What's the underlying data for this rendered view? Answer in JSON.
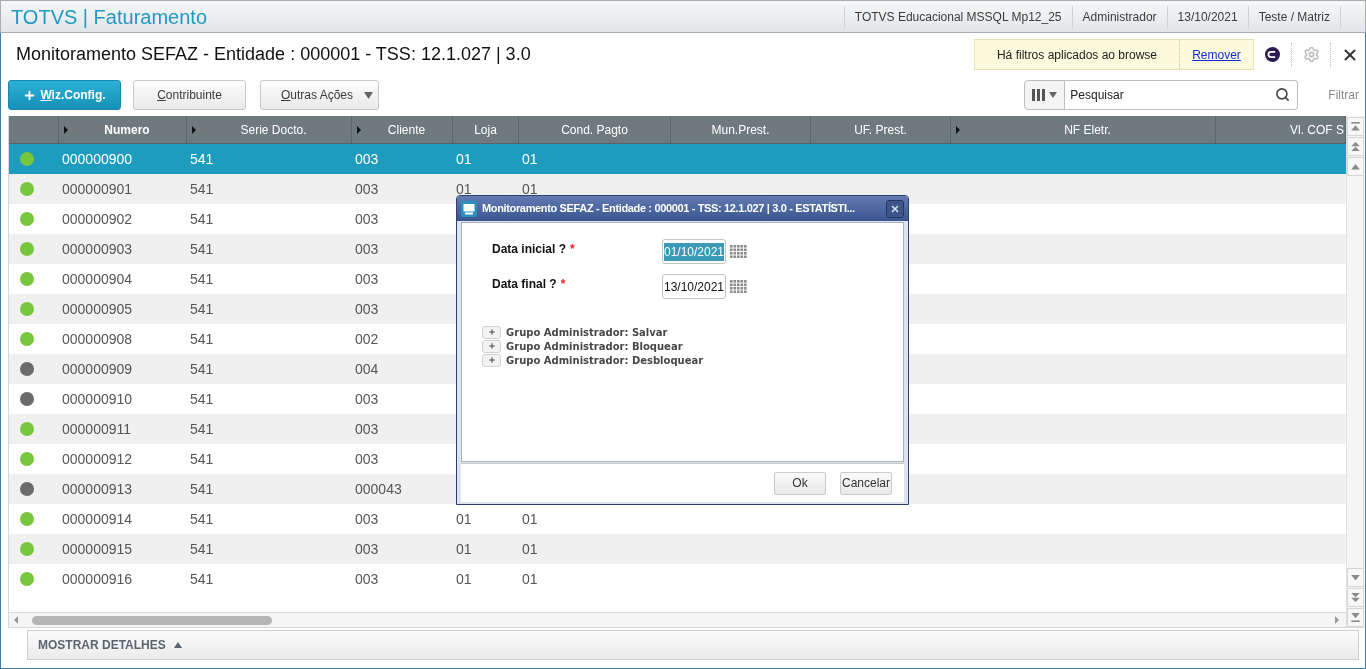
{
  "app_bar": {
    "title": "TOTVS | Faturamento",
    "info": [
      "TOTVS Educacional MSSQL Mp12_25",
      "Administrador",
      "13/10/2021",
      "Teste / Matriz"
    ]
  },
  "page": {
    "title": "Monitoramento SEFAZ - Entidade : 000001 - TSS: 12.1.027 | 3.0"
  },
  "filter_notice": {
    "text": "Há filtros aplicados ao browse",
    "link": "Remover"
  },
  "actions": [
    {
      "label": "Wiz.Config.",
      "kind": "primary"
    },
    {
      "label": "Contribuinte",
      "kind": "default"
    },
    {
      "label": "Outras Ações",
      "kind": "menu"
    }
  ],
  "search": {
    "placeholder": "Pesquisar"
  },
  "filter_link": "Filtrar",
  "table": {
    "columns": [
      {
        "label": "Numero",
        "indexed": true,
        "sorted": true
      },
      {
        "label": "Serie Docto.",
        "indexed": true,
        "sorted": false
      },
      {
        "label": "Cliente",
        "indexed": true,
        "sorted": false
      },
      {
        "label": "Loja",
        "indexed": false,
        "sorted": false
      },
      {
        "label": "Cond. Pagto",
        "indexed": false,
        "sorted": false
      },
      {
        "label": "Mun.Prest.",
        "indexed": false,
        "sorted": false
      },
      {
        "label": "UF. Prest.",
        "indexed": false,
        "sorted": false
      },
      {
        "label": "NF Eletr.",
        "indexed": true,
        "sorted": false
      },
      {
        "label": "Vl. COF S",
        "indexed": false,
        "sorted": false
      }
    ],
    "rows": [
      {
        "color": "#78c63e",
        "selected": true,
        "cells": [
          "000000900",
          "541",
          "003",
          "01",
          "01"
        ]
      },
      {
        "color": "#78c63e",
        "selected": false,
        "cells": [
          "000000901",
          "541",
          "003",
          "01",
          "01"
        ]
      },
      {
        "color": "#78c63e",
        "selected": false,
        "cells": [
          "000000902",
          "541",
          "003"
        ]
      },
      {
        "color": "#78c63e",
        "selected": false,
        "cells": [
          "000000903",
          "541",
          "003"
        ]
      },
      {
        "color": "#78c63e",
        "selected": false,
        "cells": [
          "000000904",
          "541",
          "003"
        ]
      },
      {
        "color": "#78c63e",
        "selected": false,
        "cells": [
          "000000905",
          "541",
          "003"
        ]
      },
      {
        "color": "#78c63e",
        "selected": false,
        "cells": [
          "000000908",
          "541",
          "002"
        ]
      },
      {
        "color": "#6b6b6b",
        "selected": false,
        "cells": [
          "000000909",
          "541",
          "004"
        ]
      },
      {
        "color": "#6b6b6b",
        "selected": false,
        "cells": [
          "000000910",
          "541",
          "003"
        ]
      },
      {
        "color": "#78c63e",
        "selected": false,
        "cells": [
          "000000911",
          "541",
          "003"
        ]
      },
      {
        "color": "#78c63e",
        "selected": false,
        "cells": [
          "000000912",
          "541",
          "003"
        ]
      },
      {
        "color": "#6b6b6b",
        "selected": false,
        "cells": [
          "000000913",
          "541",
          "000043"
        ]
      },
      {
        "color": "#78c63e",
        "selected": false,
        "cells": [
          "000000914",
          "541",
          "003",
          "01",
          "01"
        ]
      },
      {
        "color": "#78c63e",
        "selected": false,
        "cells": [
          "000000915",
          "541",
          "003",
          "01",
          "01"
        ]
      },
      {
        "color": "#78c63e",
        "selected": false,
        "cells": [
          "000000916",
          "541",
          "003",
          "01",
          "01"
        ]
      }
    ]
  },
  "details_toggle": {
    "label": "MOSTRAR DETALHES",
    "expanded": false
  },
  "dialog": {
    "title": "Monitoramento SEFAZ - Entidade : 000001 - TSS: 12.1.027 | 3.0 - ESTATÍSTI...",
    "fields": [
      {
        "label": "Data inicial ?",
        "required_mark": "*",
        "value": "01/10/2021",
        "text_selected": true
      },
      {
        "label": "Data final ?",
        "required_mark": "*",
        "value": "13/10/2021",
        "text_selected": false
      }
    ],
    "groups": [
      {
        "label": "Grupo Administrador: Salvar",
        "expanded": false
      },
      {
        "label": "Grupo Administrador: Bloquear",
        "expanded": false
      },
      {
        "label": "Grupo Administrador: Desbloquear",
        "expanded": false
      }
    ],
    "buttons": [
      "Ok",
      "Cancelar"
    ]
  }
}
